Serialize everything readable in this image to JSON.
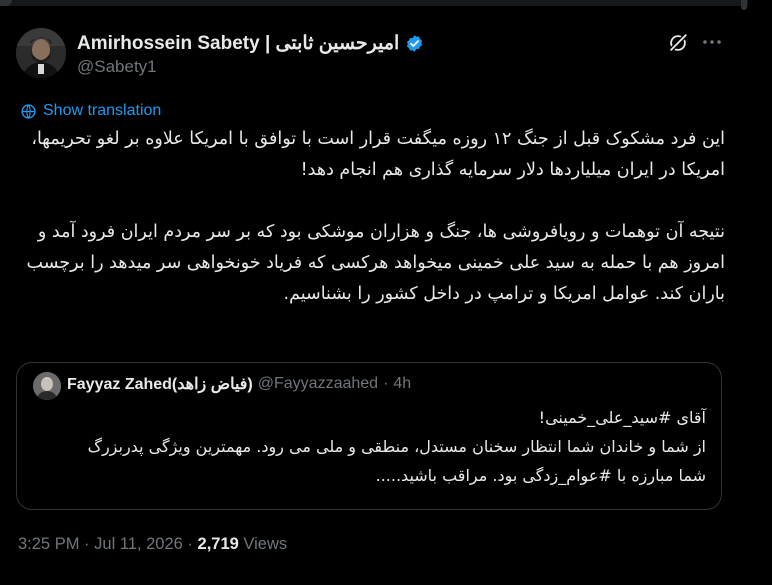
{
  "post": {
    "author_name": "Amirhossein Sabety | امیرحسین ثابتی",
    "author_handle": "@Sabety1",
    "show_translation": "Show translation",
    "paragraph_1": "این فرد مشکوک قبل از جنگ ۱۲ روزه میگفت قرار است با توافق با امریکا علاوه بر لغو تحریمها، امریکا در ایران میلیاردها دلار سرمایه گذاری هم انجام دهد!",
    "paragraph_2": "نتیجه آن توهمات و رویافروشی ها، جنگ و هزاران موشکی بود که بر سر مردم ایران فرود آمد و امروز هم با حمله به سید علی خمینی میخواهد هرکسی که فریاد خونخواهی سر میدهد را برچسب باران کند. عوامل امریکا و ترامپ در داخل کشور را بشناسیم."
  },
  "quote": {
    "name": "Fayyaz Zahed(فیاض زاهد)",
    "handle": "@Fayyazzaahed",
    "dot": "·",
    "time": "4h",
    "lines": [
      "آقای #سید_علی_خمینی!",
      "از شما و خاندان شما انتظار سخنان مستدل، منطقی و ملی می رود. مهمترین ویژگی پدربزرگ",
      "شما مبارزه با #عوام_زدگی بود. مراقب باشید....."
    ]
  },
  "meta": {
    "time": "3:25 PM",
    "separator": "·",
    "date": "Jul 11, 2026",
    "views_count": "2,719",
    "views_label": "Views"
  },
  "colors": {
    "background": "#000000",
    "text": "#e7e9ea",
    "muted": "#71767b",
    "accent": "#1d9bf0",
    "border": "#2f3336"
  },
  "icons": {
    "verified": "verified-badge-icon",
    "grok": "grok-icon",
    "more": "more-icon",
    "translate": "translate-icon"
  }
}
